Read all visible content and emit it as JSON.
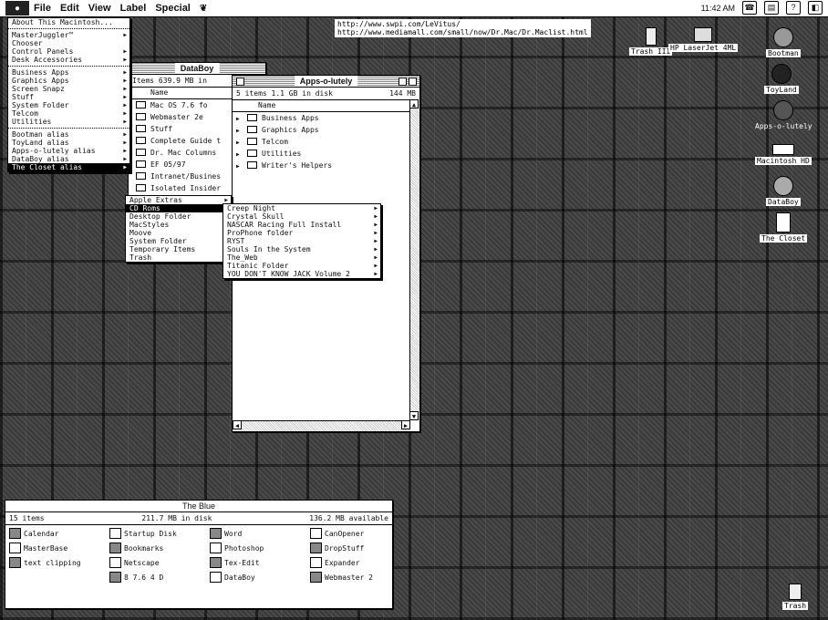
{
  "menubar": {
    "items": [
      "File",
      "Edit",
      "View",
      "Label",
      "Special"
    ],
    "time": "11:42 AM"
  },
  "url_note": {
    "line1": "http://www.swpi.com/LeVitus/",
    "line2": "http://www.mediamall.com/small/now/Dr.Mac/Dr.Maclist.html"
  },
  "apple_menu": {
    "items": [
      {
        "label": "About This Macintosh...",
        "sub": false
      },
      {
        "sep": true
      },
      {
        "label": "MasterJuggler™",
        "sub": true
      },
      {
        "label": "Chooser",
        "sub": false
      },
      {
        "label": "Control Panels",
        "sub": true
      },
      {
        "label": "Desk Accessories",
        "sub": true
      },
      {
        "sep": true
      },
      {
        "label": "Business Apps",
        "sub": true
      },
      {
        "label": "Graphics Apps",
        "sub": true
      },
      {
        "label": "Screen Snapz",
        "sub": true
      },
      {
        "label": "Stuff",
        "sub": true
      },
      {
        "label": "System Folder",
        "sub": true
      },
      {
        "label": "Telcom",
        "sub": true
      },
      {
        "label": "Utilities",
        "sub": true
      },
      {
        "sep": true
      },
      {
        "label": "Bootman alias",
        "sub": true
      },
      {
        "label": "ToyLand alias",
        "sub": true
      },
      {
        "label": "Apps-o-lutely alias",
        "sub": true
      },
      {
        "label": "DataBoy alias",
        "sub": true
      },
      {
        "label": "The Closet alias",
        "sub": true,
        "hl": true
      }
    ]
  },
  "closet_menu": {
    "items": [
      {
        "label": "Apple Extras",
        "sub": true
      },
      {
        "label": "CD Roms",
        "sub": true,
        "hl": true
      },
      {
        "label": "Desktop Folder",
        "sub": true
      },
      {
        "label": "MacStyles",
        "sub": true
      },
      {
        "label": "Moove",
        "sub": true
      },
      {
        "label": "System Folder",
        "sub": true
      },
      {
        "label": "Temporary Items",
        "sub": true
      },
      {
        "label": "Trash",
        "sub": true
      }
    ]
  },
  "cdrom_menu": {
    "items": [
      {
        "label": "Creep Night",
        "sub": true
      },
      {
        "label": "Crystal Skull",
        "sub": true
      },
      {
        "label": "NASCAR Racing Full Install",
        "sub": true
      },
      {
        "label": "ProPhone folder",
        "sub": true
      },
      {
        "label": "RYST",
        "sub": true
      },
      {
        "label": "Souls In the System",
        "sub": true
      },
      {
        "label": "The_Web",
        "sub": true
      },
      {
        "label": "Titanic Folder",
        "sub": true
      },
      {
        "label": "YOU DON'T KNOW JACK Volume 2",
        "sub": true
      }
    ]
  },
  "databoy_window": {
    "title": "DataBoy",
    "info": "Items  639.9 MB in",
    "col": "Name",
    "rows": [
      "Mac OS 7.6 fo",
      "Webmaster 2e",
      "Stuff",
      "Complete Guide t",
      "Dr. Mac Columns",
      "EF 05/97",
      "Intranet/Busines",
      "Isolated Insider"
    ]
  },
  "apps_window": {
    "title": "Apps-o-lutely",
    "info_left": "5 items    1.1 GB in disk",
    "info_right": "144 MB",
    "col": "Name",
    "rows": [
      "Business Apps",
      "Graphics Apps",
      "Telcom",
      "Utilities",
      "Writer's Helpers"
    ]
  },
  "blue_window": {
    "title": "The Blue",
    "info_left": "15 items",
    "info_mid": "211.7 MB in disk",
    "info_right": "136.2 MB available",
    "items": [
      [
        "Calendar",
        "Startup Disk",
        "Word",
        "CanOpener"
      ],
      [
        "MasterBase",
        "Bookmarks",
        "Photoshop",
        "DropStuff"
      ],
      [
        "text clipping",
        "Netscape",
        "Tex-Edit",
        "Expander"
      ],
      [
        "",
        "8 7.6 4 D",
        "DataBoy",
        "Webmaster 2"
      ]
    ]
  },
  "desktop_icons": [
    {
      "label": "Trash III"
    },
    {
      "label": "HP LaserJet 4ML"
    },
    {
      "label": "Bootman"
    },
    {
      "label": "ToyLand"
    },
    {
      "label": "Apps-o-lutely"
    },
    {
      "label": "Macintosh HD"
    },
    {
      "label": "DataBoy"
    },
    {
      "label": "The Closet"
    },
    {
      "label": "Trash"
    }
  ]
}
